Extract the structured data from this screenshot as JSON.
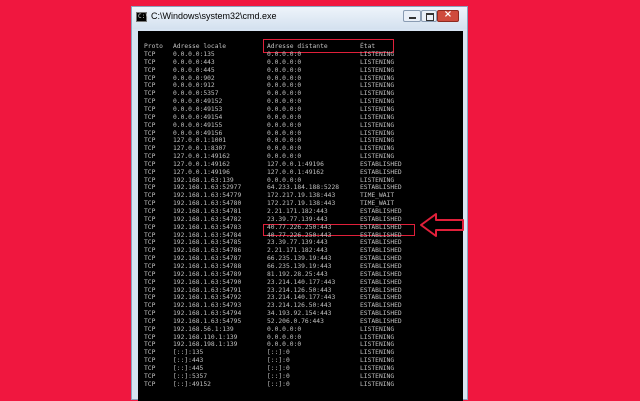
{
  "window": {
    "title": "C:\\Windows\\system32\\cmd.exe",
    "icon": "cmd-icon"
  },
  "header": {
    "proto": "Proto",
    "local": "Adresse locale",
    "remote": "Adresse distante",
    "state": "État"
  },
  "rows": [
    [
      "TCP",
      "0.0.0.0:135",
      "0.0.0.0:0",
      "LISTENING"
    ],
    [
      "TCP",
      "0.0.0.0:443",
      "0.0.0.0:0",
      "LISTENING"
    ],
    [
      "TCP",
      "0.0.0.0:445",
      "0.0.0.0:0",
      "LISTENING"
    ],
    [
      "TCP",
      "0.0.0.0:902",
      "0.0.0.0:0",
      "LISTENING"
    ],
    [
      "TCP",
      "0.0.0.0:912",
      "0.0.0.0:0",
      "LISTENING"
    ],
    [
      "TCP",
      "0.0.0.0:5357",
      "0.0.0.0:0",
      "LISTENING"
    ],
    [
      "TCP",
      "0.0.0.0:49152",
      "0.0.0.0:0",
      "LISTENING"
    ],
    [
      "TCP",
      "0.0.0.0:49153",
      "0.0.0.0:0",
      "LISTENING"
    ],
    [
      "TCP",
      "0.0.0.0:49154",
      "0.0.0.0:0",
      "LISTENING"
    ],
    [
      "TCP",
      "0.0.0.0:49155",
      "0.0.0.0:0",
      "LISTENING"
    ],
    [
      "TCP",
      "0.0.0.0:49156",
      "0.0.0.0:0",
      "LISTENING"
    ],
    [
      "TCP",
      "127.0.0.1:1001",
      "0.0.0.0:0",
      "LISTENING"
    ],
    [
      "TCP",
      "127.0.0.1:8307",
      "0.0.0.0:0",
      "LISTENING"
    ],
    [
      "TCP",
      "127.0.0.1:49162",
      "0.0.0.0:0",
      "LISTENING"
    ],
    [
      "TCP",
      "127.0.0.1:49162",
      "127.0.0.1:49196",
      "ESTABLISHED"
    ],
    [
      "TCP",
      "127.0.0.1:49196",
      "127.0.0.1:49162",
      "ESTABLISHED"
    ],
    [
      "TCP",
      "192.168.1.63:139",
      "0.0.0.0:0",
      "LISTENING"
    ],
    [
      "TCP",
      "192.168.1.63:52977",
      "64.233.184.188:5228",
      "ESTABLISHED"
    ],
    [
      "TCP",
      "192.168.1.63:54779",
      "172.217.19.138:443",
      "TIME_WAIT"
    ],
    [
      "TCP",
      "192.168.1.63:54780",
      "172.217.19.138:443",
      "TIME_WAIT"
    ],
    [
      "TCP",
      "192.168.1.63:54781",
      "2.21.171.182:443",
      "ESTABLISHED"
    ],
    [
      "TCP",
      "192.168.1.63:54782",
      "23.39.77.139:443",
      "ESTABLISHED"
    ],
    [
      "TCP",
      "192.168.1.63:54783",
      "40.77.226.250:443",
      "ESTABLISHED"
    ],
    [
      "TCP",
      "192.168.1.63:54784",
      "40.77.226.250:443",
      "ESTABLISHED"
    ],
    [
      "TCP",
      "192.168.1.63:54785",
      "23.39.77.139:443",
      "ESTABLISHED"
    ],
    [
      "TCP",
      "192.168.1.63:54786",
      "2.21.171.182:443",
      "ESTABLISHED"
    ],
    [
      "TCP",
      "192.168.1.63:54787",
      "66.235.139.19:443",
      "ESTABLISHED"
    ],
    [
      "TCP",
      "192.168.1.63:54788",
      "66.235.139.19:443",
      "ESTABLISHED"
    ],
    [
      "TCP",
      "192.168.1.63:54789",
      "81.192.28.25:443",
      "ESTABLISHED"
    ],
    [
      "TCP",
      "192.168.1.63:54790",
      "23.214.140.177:443",
      "ESTABLISHED"
    ],
    [
      "TCP",
      "192.168.1.63:54791",
      "23.214.126.50:443",
      "ESTABLISHED"
    ],
    [
      "TCP",
      "192.168.1.63:54792",
      "23.214.140.177:443",
      "ESTABLISHED"
    ],
    [
      "TCP",
      "192.168.1.63:54793",
      "23.214.126.50:443",
      "ESTABLISHED"
    ],
    [
      "TCP",
      "192.168.1.63:54794",
      "34.193.92.154:443",
      "ESTABLISHED"
    ],
    [
      "TCP",
      "192.168.1.63:54795",
      "52.206.0.76:443",
      "ESTABLISHED"
    ],
    [
      "TCP",
      "192.168.56.1:139",
      "0.0.0.0:0",
      "LISTENING"
    ],
    [
      "TCP",
      "192.168.110.1:139",
      "0.0.0.0:0",
      "LISTENING"
    ],
    [
      "TCP",
      "192.168.198.1:139",
      "0.0.0.0:0",
      "LISTENING"
    ],
    [
      "TCP",
      "[::]:135",
      "[::]:0",
      "LISTENING"
    ],
    [
      "TCP",
      "[::]:443",
      "[::]:0",
      "LISTENING"
    ],
    [
      "TCP",
      "[::]:445",
      "[::]:0",
      "LISTENING"
    ],
    [
      "TCP",
      "[::]:5357",
      "[::]:0",
      "LISTENING"
    ],
    [
      "TCP",
      "[::]:49152",
      "[::]:0",
      "LISTENING"
    ]
  ],
  "highlight": {
    "row_index": 22,
    "color": "#e0203a",
    "arrow_icon": "left-arrow-icon"
  },
  "colors": {
    "background": "#f0173f",
    "console_bg": "#000000",
    "console_text": "#c0c0c0"
  }
}
